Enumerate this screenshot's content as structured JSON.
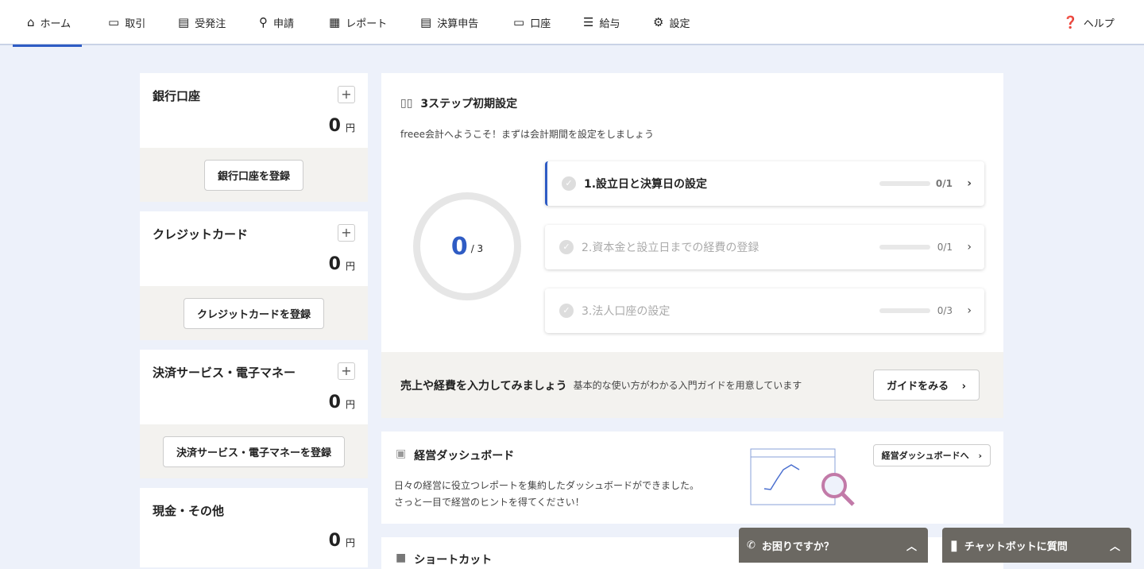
{
  "nav": {
    "items": [
      {
        "label": "ホーム",
        "icon": "home-icon"
      },
      {
        "label": "取引",
        "icon": "tray-icon"
      },
      {
        "label": "受発注",
        "icon": "document-icon"
      },
      {
        "label": "申請",
        "icon": "user-check-icon"
      },
      {
        "label": "レポート",
        "icon": "chart-icon"
      },
      {
        "label": "決算申告",
        "icon": "document-icon"
      },
      {
        "label": "口座",
        "icon": "card-icon"
      },
      {
        "label": "給与",
        "icon": "list-icon"
      },
      {
        "label": "設定",
        "icon": "gear-icon"
      }
    ],
    "help": "ヘルプ"
  },
  "accounts": [
    {
      "title": "銀行口座",
      "amount": "0",
      "unit": "円",
      "button": "銀行口座を登録"
    },
    {
      "title": "クレジットカード",
      "amount": "0",
      "unit": "円",
      "button": "クレジットカードを登録"
    },
    {
      "title": "決済サービス・電子マネー",
      "amount": "0",
      "unit": "円",
      "button": "決済サービス・電子マネーを登録"
    },
    {
      "title": "現金・その他",
      "amount": "0",
      "unit": "円"
    }
  ],
  "setup": {
    "title": "3ステップ初期設定",
    "subtitle": "freee会計へようこそ！まずは会計期間を設定をしましょう",
    "progress_done": "0",
    "progress_total": "/ 3",
    "steps": [
      {
        "label": "1.設立日と決算日の設定",
        "count": "0/1"
      },
      {
        "label": "2.資本金と設立日までの経費の登録",
        "count": "0/1"
      },
      {
        "label": "3.法人口座の設定",
        "count": "0/3"
      }
    ],
    "guide_title": "売上や経費を入力してみましょう",
    "guide_desc": "基本的な使い方がわかる入門ガイドを用意しています",
    "guide_button": "ガイドをみる"
  },
  "dashboard": {
    "title": "経営ダッシュボード",
    "line1": "日々の経営に役立つレポートを集約したダッシュボードができました。",
    "line2": "さっと一目で経営のヒントを得てください！",
    "button": "経営ダッシュボードへ"
  },
  "shortcut": {
    "title": "ショートカット"
  },
  "widgets": {
    "help": "お困りですか？",
    "chatbot": "チャットボットに質問"
  }
}
